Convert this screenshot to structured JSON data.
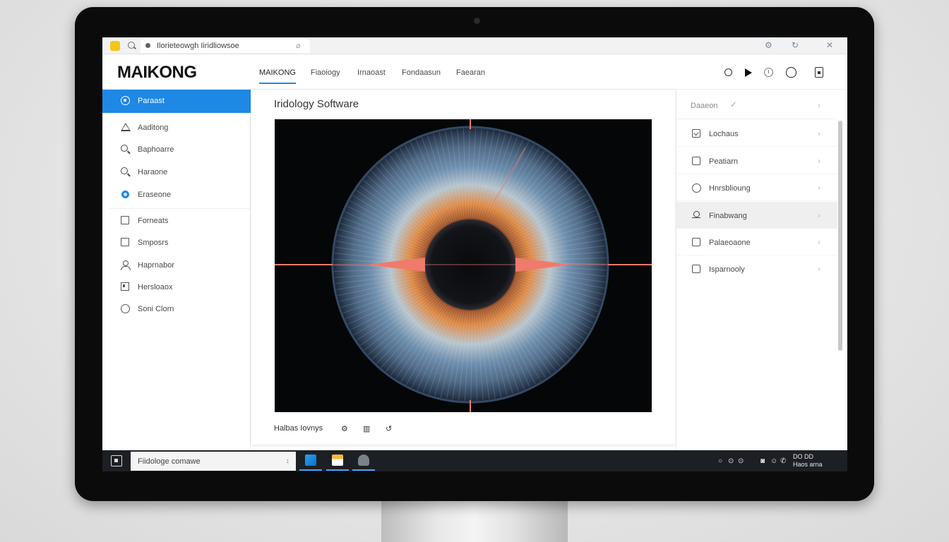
{
  "browser": {
    "address_text": "Ilorieteowgh Iiridliowsoe",
    "addr_glyph": "⌀",
    "ctrl_settings": "⚙",
    "ctrl_refresh": "↻",
    "ctrl_close": "✕"
  },
  "header": {
    "logo": "MAIKONG",
    "nav": [
      "MAIKONG",
      "Fiaoiogy",
      "Irnaoast",
      "Fondaasun",
      "Faearan"
    ]
  },
  "sidebar": {
    "items": [
      {
        "label": "Paraast",
        "icon": "target-icon"
      },
      {
        "label": "Aaditong",
        "icon": "warning-icon"
      },
      {
        "label": "Baphoarre",
        "icon": "search-icon"
      },
      {
        "label": "Haraone",
        "icon": "search-icon"
      },
      {
        "label": "Eraseone",
        "icon": "dot-icon"
      },
      {
        "label": "Forneats",
        "icon": "square-icon"
      },
      {
        "label": "Smposrs",
        "icon": "square-icon"
      },
      {
        "label": "Haprnabor",
        "icon": "user-icon"
      },
      {
        "label": "Hersloaox",
        "icon": "frame-icon"
      },
      {
        "label": "Soni Clorn",
        "icon": "circle-icon"
      }
    ]
  },
  "main": {
    "title": "Iridology Software",
    "footer_label": "Halbas Iovnys",
    "footer_icons": [
      "⚙",
      "▥",
      "↺"
    ]
  },
  "right_panel": {
    "header": "Daaeon",
    "header_check": "✓",
    "chevron": "›",
    "items": [
      {
        "label": "Lochaus",
        "icon": "image-icon"
      },
      {
        "label": "Peatiarn",
        "icon": "square-icon"
      },
      {
        "label": "Hnrsblioung",
        "icon": "loop-icon"
      },
      {
        "label": "Finabwang",
        "icon": "key-icon"
      },
      {
        "label": "Palaeoaone",
        "icon": "square-icon"
      },
      {
        "label": "Isparnooly",
        "icon": "square-icon"
      }
    ]
  },
  "taskbar": {
    "search_text": "Fiidologe comawe",
    "search_caret": "↕",
    "tray": [
      "○",
      "⊙",
      "⊙",
      "◙",
      "☺",
      "✆"
    ],
    "clock_line1": "DO     DD",
    "clock_line2": "Haos arna"
  },
  "colors": {
    "accent": "#1e88e5",
    "iris_marker": "#f07a6c",
    "taskbar": "#1c1f24"
  }
}
